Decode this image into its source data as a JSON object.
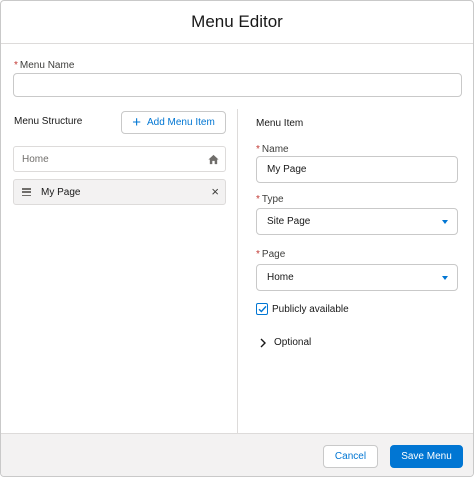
{
  "header": {
    "title": "Menu Editor"
  },
  "menu_name": {
    "required_mark": "*",
    "label": "Menu Name",
    "value": ""
  },
  "structure": {
    "title": "Menu Structure",
    "add_button_label": "Add Menu Item",
    "items": [
      {
        "label": "Home",
        "icon": "home-icon"
      },
      {
        "label": "My Page",
        "icon": "drag-handle-icon"
      }
    ]
  },
  "menu_item": {
    "title": "Menu Item",
    "name": {
      "required_mark": "*",
      "label": "Name",
      "value": "My Page"
    },
    "type": {
      "required_mark": "*",
      "label": "Type",
      "value": "Site Page"
    },
    "page": {
      "required_mark": "*",
      "label": "Page",
      "value": "Home"
    },
    "publicly_available": {
      "label": "Publicly available",
      "checked": true
    },
    "optional_label": "Optional"
  },
  "footer": {
    "cancel_label": "Cancel",
    "save_label": "Save Menu"
  },
  "colors": {
    "accent": "#0176d3",
    "required": "#c23934",
    "footer_bg": "#f3f2f2",
    "border": "#c9c9c9"
  }
}
